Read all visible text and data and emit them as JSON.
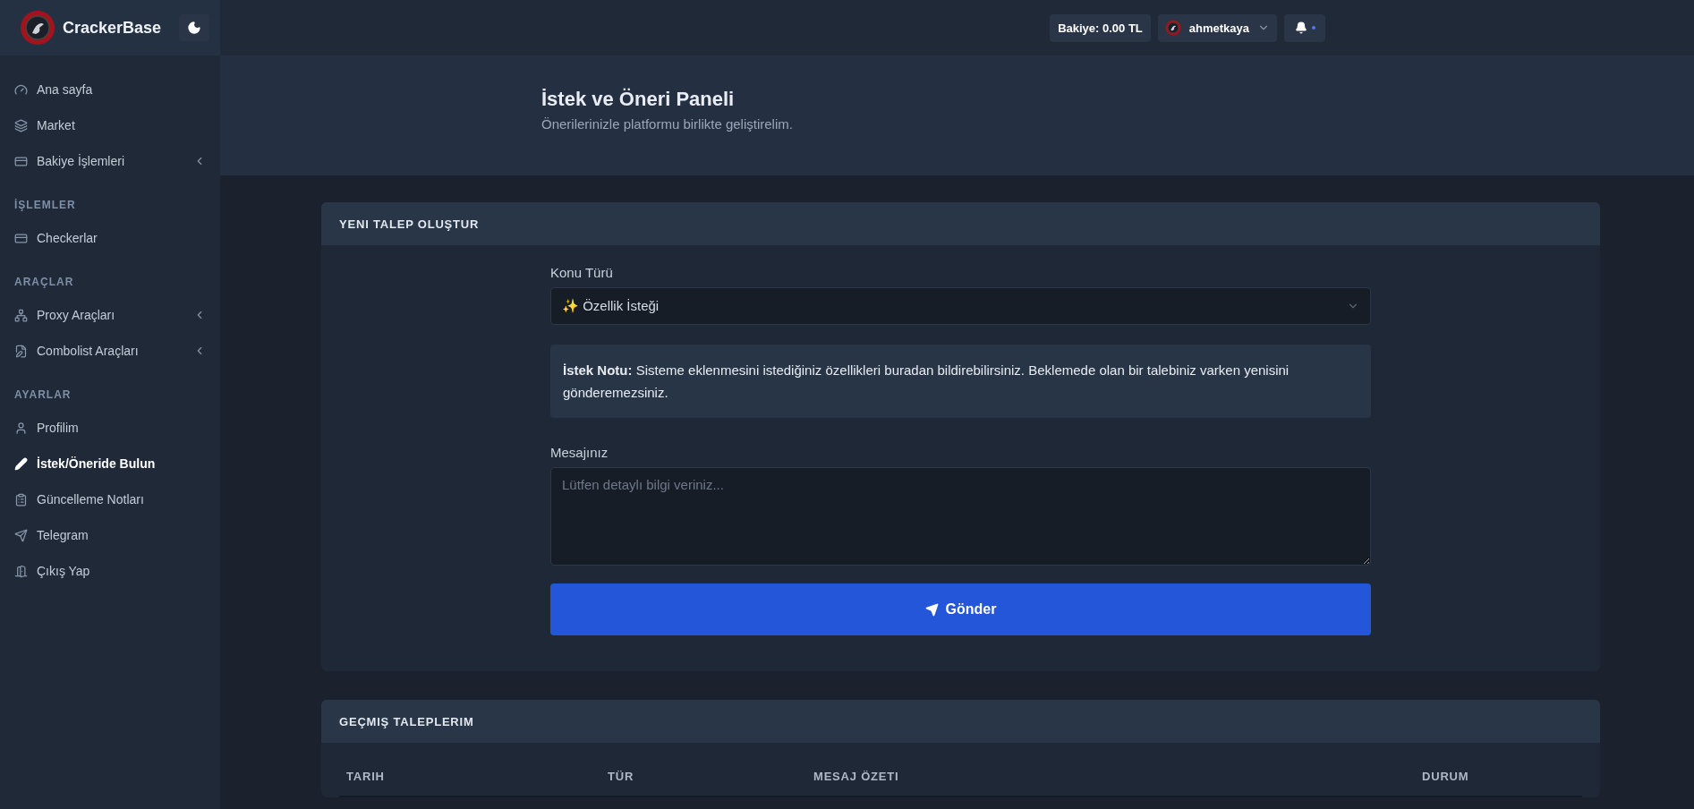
{
  "brand": {
    "name": "CrackerBase"
  },
  "topbar": {
    "balance": "Bakiye: 0.00 TL",
    "user": "ahmetkaya",
    "notification_unread": true
  },
  "sidebar": {
    "groups": [
      {
        "items": [
          {
            "label": "Ana sayfa",
            "selected": false,
            "has_submenu": false
          },
          {
            "label": "Market",
            "selected": false,
            "has_submenu": false
          },
          {
            "label": "Bakiye İşlemleri",
            "selected": false,
            "has_submenu": true
          }
        ]
      },
      {
        "heading": "İŞLEMLER",
        "items": [
          {
            "label": "Checkerlar",
            "selected": false,
            "has_submenu": false
          }
        ]
      },
      {
        "heading": "ARAÇLAR",
        "items": [
          {
            "label": "Proxy Araçları",
            "selected": false,
            "has_submenu": true
          },
          {
            "label": "Combolist Araçları",
            "selected": false,
            "has_submenu": true
          }
        ]
      },
      {
        "heading": "AYARLAR",
        "items": [
          {
            "label": "Profilim",
            "selected": false,
            "has_submenu": false
          },
          {
            "label": "İstek/Öneride Bulun",
            "selected": true,
            "has_submenu": false
          },
          {
            "label": "Güncelleme Notları",
            "selected": false,
            "has_submenu": false
          },
          {
            "label": "Telegram",
            "selected": false,
            "has_submenu": false
          },
          {
            "label": "Çıkış Yap",
            "selected": false,
            "has_submenu": false
          }
        ]
      }
    ]
  },
  "page_header": {
    "title": "İstek ve Öneri Paneli",
    "subtitle": "Önerilerinizle platformu birlikte geliştirelim."
  },
  "new_request": {
    "title": "YENI TALEP OLUŞTUR",
    "type_label": "Konu Türü",
    "type_value": "✨ Özellik İsteği",
    "note": "**İstek Notu:** Sisteme eklenmesini istediğiniz özellikleri buradan bildirebilirsiniz. Beklemede olan bir talebiniz varken yenisini gönderemezsiniz.",
    "message_label": "Mesajınız",
    "message_placeholder": "Lütfen detaylı bilgi veriniz...",
    "submit": "Gönder"
  },
  "history": {
    "title": "GEÇMIŞ TALEPLERIM",
    "columns": [
      "TARIH",
      "TÜR",
      "MESAJ ÖZETI",
      "DURUM"
    ]
  }
}
